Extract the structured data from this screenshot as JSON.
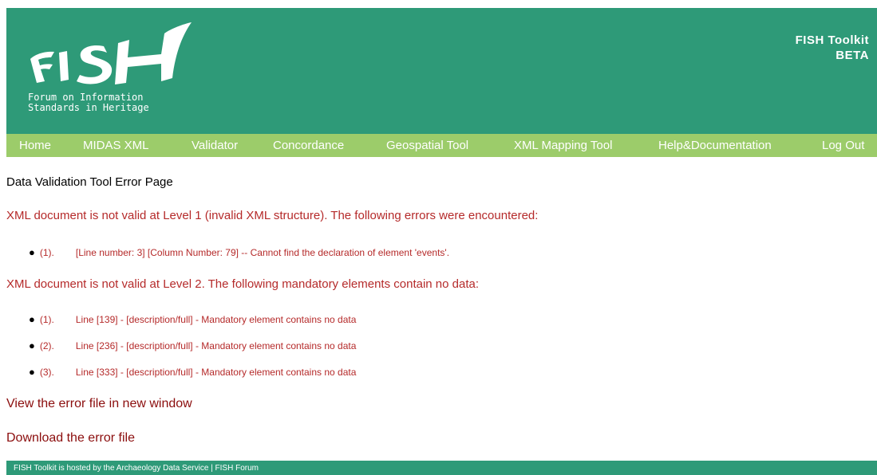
{
  "header": {
    "logo_text": "FISH",
    "logo_subtitle": [
      "Forum on Information",
      "Standards in Heritage"
    ],
    "toolkit_title": "FISH Toolkit",
    "toolkit_badge": "BETA"
  },
  "nav": {
    "items": [
      {
        "label": "Home"
      },
      {
        "label": "MIDAS XML"
      },
      {
        "label": "Validator"
      },
      {
        "label": "Concordance"
      },
      {
        "label": "Geospatial Tool"
      },
      {
        "label": "XML Mapping Tool"
      },
      {
        "label": "Help&Documentation"
      },
      {
        "label": "Log Out"
      }
    ]
  },
  "main": {
    "page_title": "Data Validation Tool Error Page",
    "level1": {
      "heading": "XML document is not valid at Level 1 (invalid XML structure). The following errors were encountered:",
      "errors": [
        {
          "num": "(1).",
          "text": "[Line number: 3] [Column Number: 79] -- Cannot find the declaration of element 'events'."
        }
      ]
    },
    "level2": {
      "heading": "XML document is not valid at Level 2. The following mandatory elements contain no data:",
      "errors": [
        {
          "num": "(1).",
          "text": "Line [139] - [description/full] - Mandatory element contains no data"
        },
        {
          "num": "(2).",
          "text": "Line [236] - [description/full] - Mandatory element contains no data"
        },
        {
          "num": "(3).",
          "text": "Line [333] - [description/full] - Mandatory element contains no data"
        }
      ]
    },
    "view_link": "View the error file in new window",
    "download_link": "Download the error file"
  },
  "footer": {
    "text": "FISH Toolkit is hosted by the Archaeology Data Service | FISH Forum"
  },
  "colors": {
    "header_bg": "#2e9a78",
    "nav_bg": "#9ccc6a",
    "error_red": "#b52a2a",
    "link_dark_red": "#8b0d0d"
  }
}
